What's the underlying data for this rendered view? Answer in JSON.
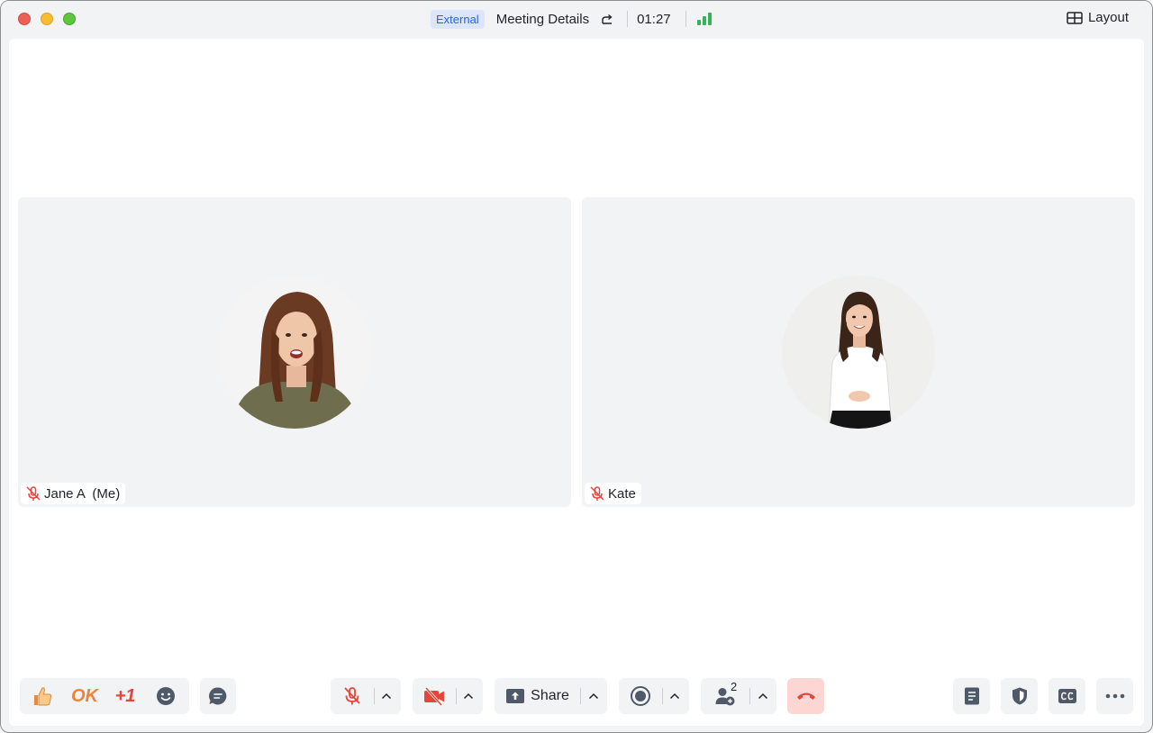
{
  "titlebar": {
    "badge": "External",
    "meeting_title": "Meeting Details",
    "timer": "01:27",
    "layout_label": "Layout",
    "signal_color": "#34b35a"
  },
  "participants": [
    {
      "name": "Jane A  (Me)",
      "muted": true,
      "avatar": "woman-brown-hair-olive-shirt"
    },
    {
      "name": "Kate",
      "muted": true,
      "avatar": "woman-white-blouse-black-skirt"
    }
  ],
  "reactions": {
    "thumbs": "thumbs-up-icon",
    "ok_label": "OK",
    "plus_label": "+1",
    "emoji": "smiley-icon"
  },
  "toolbar": {
    "share_label": "Share",
    "participants_count": "2",
    "leave_color": "#e5453a"
  }
}
